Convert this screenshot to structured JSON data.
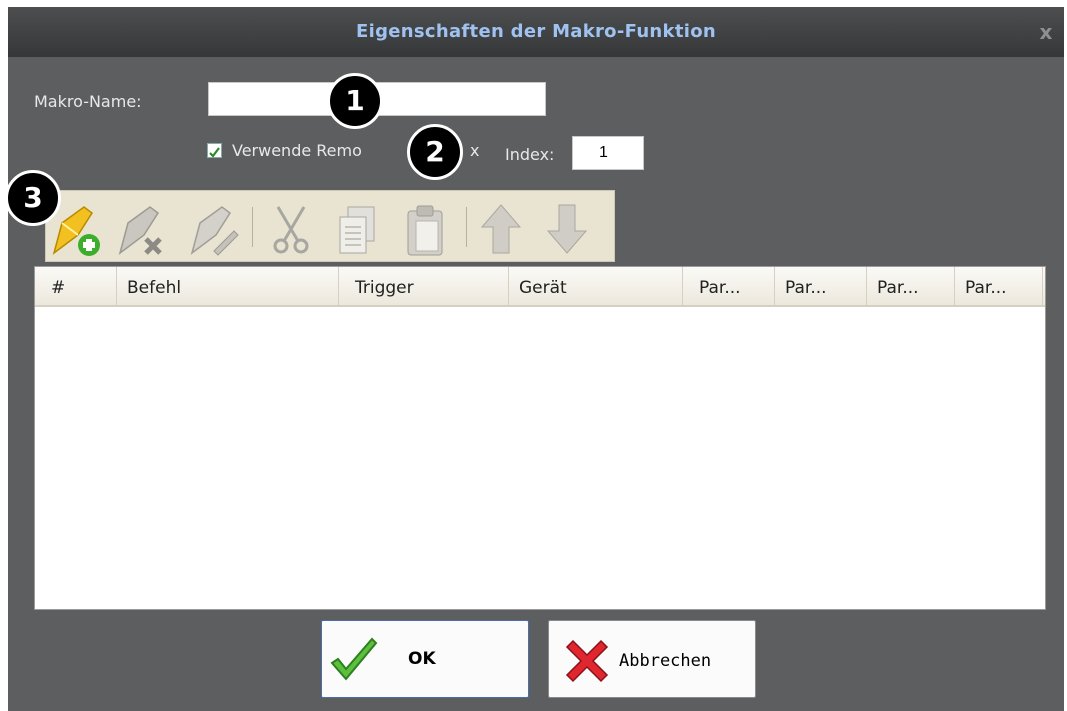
{
  "dialog": {
    "title": "Eigenschaften der Makro-Funktion",
    "close_glyph": "x"
  },
  "form": {
    "macro_name_label": "Makro-Name:",
    "macro_name_value": "",
    "remote_checkbox_label": "Verwende Remo",
    "remote_checkbox_tail": "x",
    "remote_checkbox_checked": true,
    "index_label": "Index:",
    "index_value": "1"
  },
  "toolbar": {
    "buttons": [
      {
        "name": "add-command",
        "icon": "wand-plus-icon",
        "enabled": true
      },
      {
        "name": "delete-command",
        "icon": "wand-delete-icon",
        "enabled": false
      },
      {
        "name": "edit-command",
        "icon": "wand-edit-icon",
        "enabled": false
      },
      {
        "name": "cut",
        "icon": "scissors-icon",
        "enabled": false
      },
      {
        "name": "copy",
        "icon": "copy-icon",
        "enabled": false
      },
      {
        "name": "paste",
        "icon": "paste-icon",
        "enabled": false
      },
      {
        "name": "move-up",
        "icon": "arrow-up-icon",
        "enabled": false
      },
      {
        "name": "move-down",
        "icon": "arrow-down-icon",
        "enabled": false
      }
    ]
  },
  "table": {
    "columns": [
      "#",
      "Befehl",
      "Trigger",
      "Gerät",
      "Par...",
      "Par...",
      "Par...",
      "Par..."
    ],
    "rows": []
  },
  "buttons": {
    "ok_label": "OK",
    "cancel_label": "Abbrechen"
  },
  "markers": [
    "1",
    "2",
    "3"
  ],
  "colors": {
    "dialog_bg": "#5d5e5f",
    "title_text": "#9fc2f0",
    "toolbar_bg": "#e9e3d1",
    "ok_check": "#4caf3a",
    "cancel_x": "#d8202a"
  }
}
